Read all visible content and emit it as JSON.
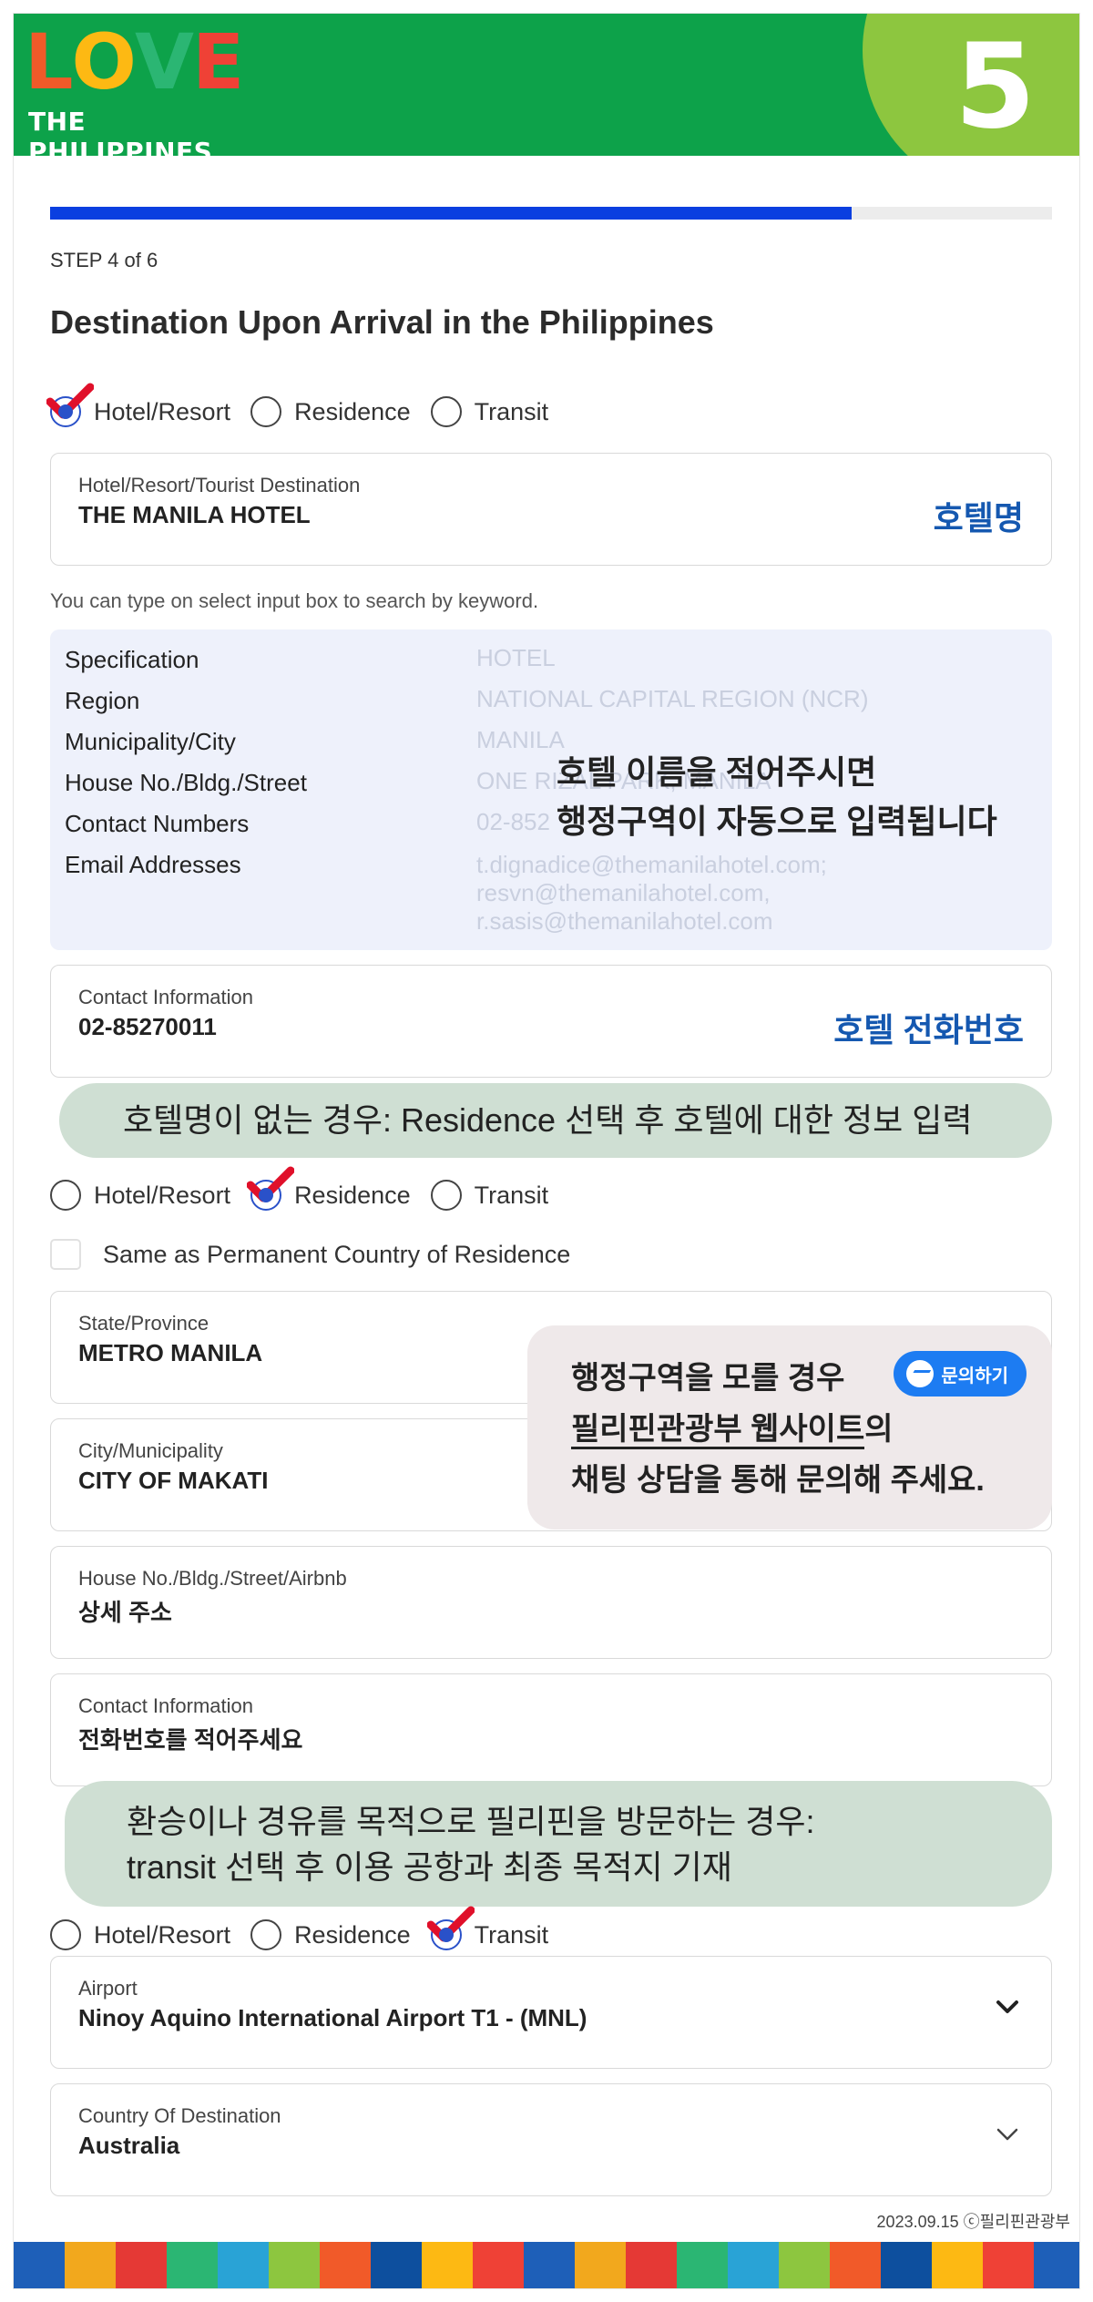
{
  "header": {
    "logo_word": "LOVE",
    "logo_sub": "THE PHILIPPINES",
    "step_number": "5"
  },
  "progress": {
    "fraction": 0.8
  },
  "step_label": "STEP 4 of 6",
  "page_title": "Destination Upon Arrival in the Philippines",
  "radio_options": [
    "Hotel/Resort",
    "Residence",
    "Transit"
  ],
  "section_hotel": {
    "selected": "Hotel/Resort",
    "field": {
      "label": "Hotel/Resort/Tourist Destination",
      "value": "THE MANILA HOTEL",
      "note": "호텔명"
    },
    "hint": "You can type on select input box to search by keyword.",
    "spec": {
      "rows": [
        {
          "label": "Specification",
          "value": "HOTEL"
        },
        {
          "label": "Region",
          "value": "NATIONAL CAPITAL REGION (NCR)"
        },
        {
          "label": "Municipality/City",
          "value": "MANILA"
        },
        {
          "label": "House No./Bldg./Street",
          "value": "ONE RIZAL PARK, MANILA"
        },
        {
          "label": "Contact Numbers",
          "value": "02-852"
        },
        {
          "label": "Email Addresses",
          "value": "t.dignadice@themanilahotel.com; resvn@themanilahotel.com, r.sasis@themanilahotel.com"
        }
      ],
      "overlay_line1": "호텔 이름을 적어주시면",
      "overlay_line2": "행정구역이 자동으로 입력됩니다"
    },
    "contact": {
      "label": "Contact Information",
      "value": "02-85270011",
      "note": "호텔 전화번호"
    }
  },
  "bubble_residence": "호텔명이 없는 경우: Residence 선택 후 호텔에 대한 정보 입력",
  "section_residence": {
    "selected": "Residence",
    "checkbox_label": "Same as Permanent Country of Residence",
    "state": {
      "label": "State/Province",
      "value": "METRO MANILA"
    },
    "city": {
      "label": "City/Municipality",
      "value": "CITY OF MAKATI"
    },
    "house": {
      "label": "House No./Bldg./Street/Airbnb",
      "value": "상세 주소"
    },
    "contact": {
      "label": "Contact Information",
      "value": "전화번호를 적어주세요"
    },
    "chat": {
      "line1": "행정구역을 모를 경우",
      "line2_underlined": "필리핀관광부 웹사이트",
      "line2_rest": "의",
      "line3": "채팅 상담을 통해 문의해 주세요.",
      "button_label": "문의하기",
      "button_icon": "messenger-icon",
      "button_color": "#1d7cf2"
    }
  },
  "bubble_transit_line1": "환승이나 경유를 목적으로 필리핀을 방문하는 경우:",
  "bubble_transit_line2": "transit 선택 후 이용 공항과 최종 목적지 기재",
  "section_transit": {
    "selected": "Transit",
    "airport": {
      "label": "Airport",
      "value": "Ninoy Aquino International Airport T1 - (MNL)"
    },
    "destination": {
      "label": "Country Of Destination",
      "value": "Australia"
    }
  },
  "footer_credit": "2023.09.15 ⓒ필리핀관광부",
  "colors": {
    "header_green": "#0da24a",
    "badge_green": "#8dc63f",
    "progress_blue": "#0a3fe0",
    "note_blue": "#1558b0",
    "check_red": "#e0102a",
    "bubble_green": "#cfdfd3"
  }
}
